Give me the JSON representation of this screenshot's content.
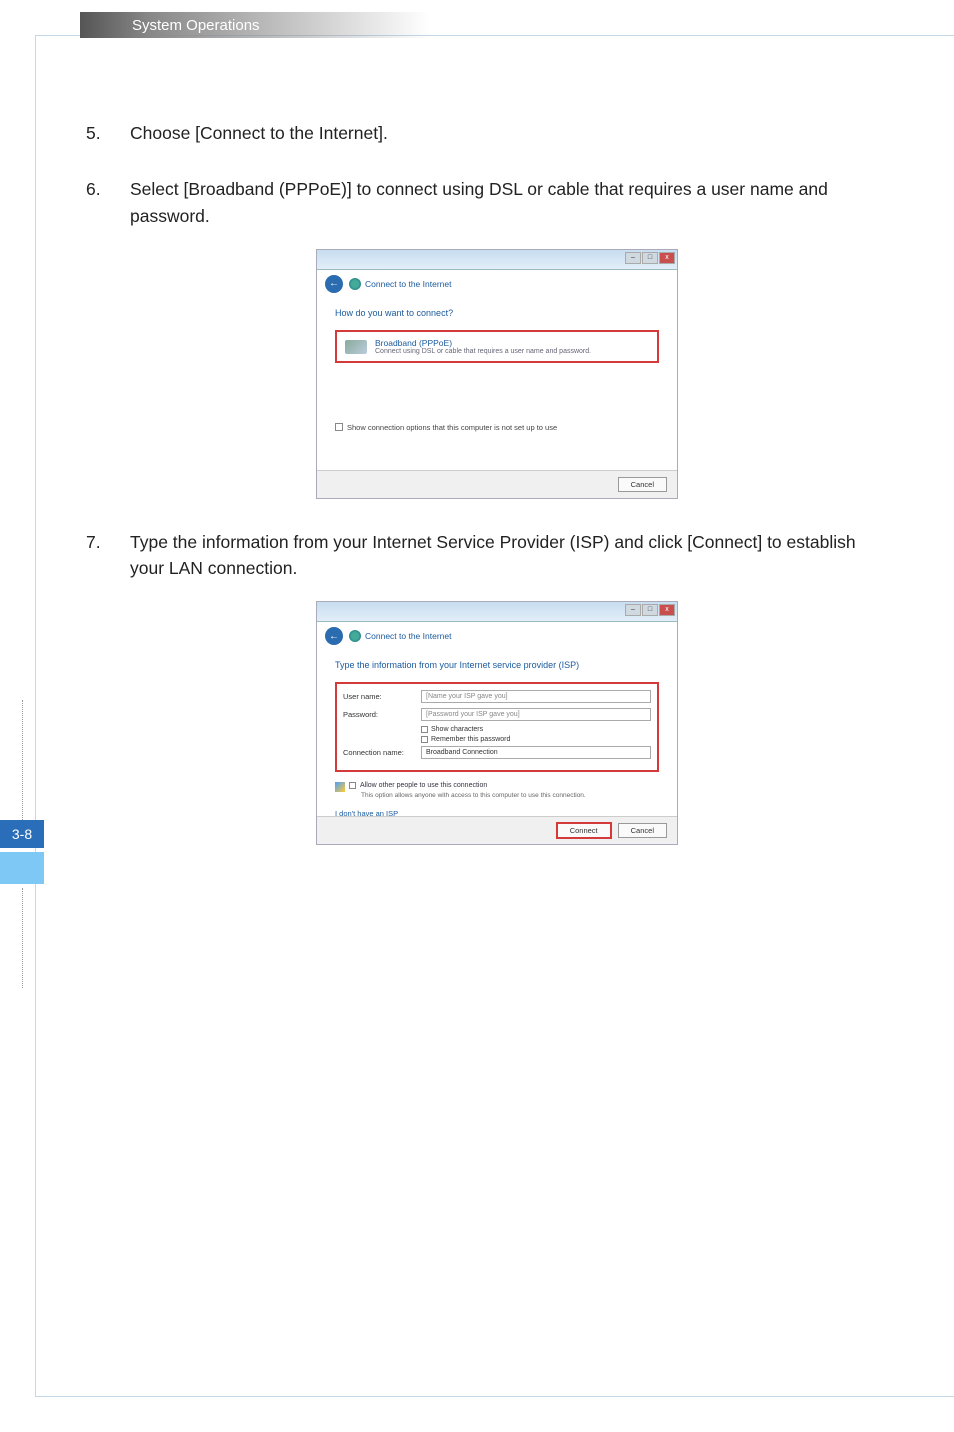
{
  "header": {
    "title": "System Operations"
  },
  "pageMarker": {
    "number": "3-8"
  },
  "steps": {
    "s5": {
      "num": "5.",
      "text": "Choose [Connect to the Internet]."
    },
    "s6": {
      "num": "6.",
      "text": "Select [Broadband (PPPoE)] to connect using DSL or cable that requires a user name and password."
    },
    "s7": {
      "num": "7.",
      "text": "Type the information from your Internet Service Provider (ISP) and click [Connect] to establish your LAN connection."
    }
  },
  "dialog1": {
    "title": "Connect to the Internet",
    "prompt": "How do you want to connect?",
    "optionTitle": "Broadband (PPPoE)",
    "optionSub": "Connect using DSL or cable that requires a user name and password.",
    "checkboxLabel": "Show connection options that this computer is not set up to use",
    "cancel": "Cancel",
    "minimize": "–",
    "maximize": "□",
    "close": "x"
  },
  "dialog2": {
    "title": "Connect to the Internet",
    "prompt": "Type the information from your Internet service provider (ISP)",
    "userLabel": "User name:",
    "userPlaceholder": "[Name your ISP gave you]",
    "passLabel": "Password:",
    "passPlaceholder": "[Password your ISP gave you]",
    "showChars": "Show characters",
    "remember": "Remember this password",
    "connLabel": "Connection name:",
    "connValue": "Broadband Connection",
    "allowOthers": "Allow other people to use this connection",
    "allowSub": "This option allows anyone with access to this computer to use this connection.",
    "noIsp": "I don't have an ISP",
    "connect": "Connect",
    "cancel": "Cancel",
    "minimize": "–",
    "maximize": "□",
    "close": "x"
  }
}
